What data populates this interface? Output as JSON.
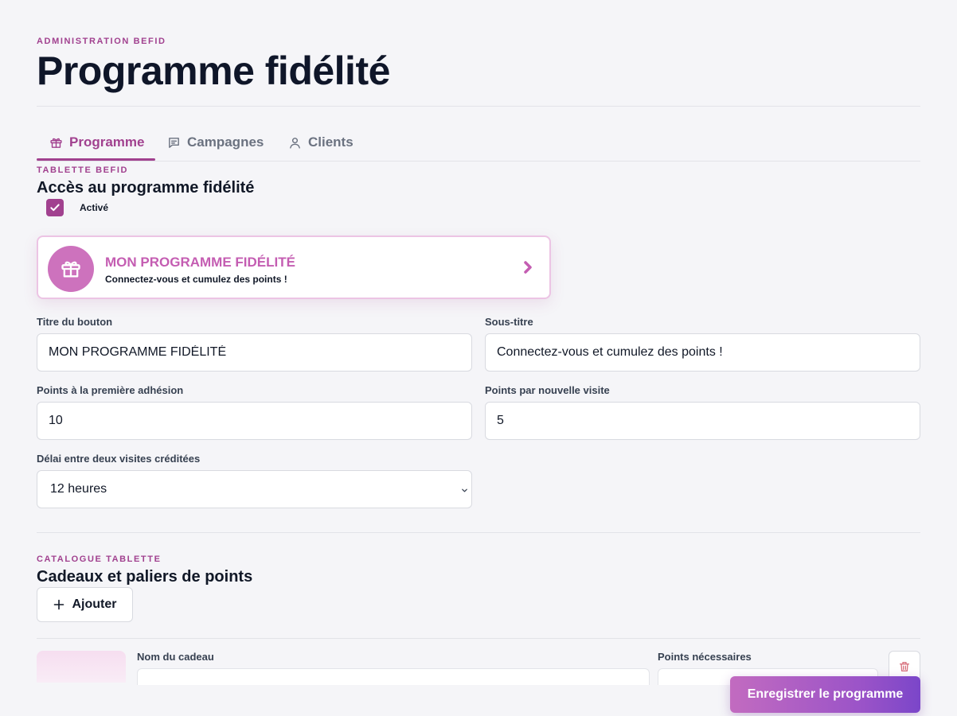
{
  "header": {
    "eyebrow": "ADMINISTRATION BEFID",
    "title": "Programme fidélité"
  },
  "tabs": [
    {
      "label": "Programme",
      "icon": "gift-icon",
      "active": true
    },
    {
      "label": "Campagnes",
      "icon": "chat-icon",
      "active": false
    },
    {
      "label": "Clients",
      "icon": "user-icon",
      "active": false
    }
  ],
  "access": {
    "eyebrow": "TABLETTE BEFID",
    "title": "Accès au programme fidélité",
    "checkbox_label": "Activé",
    "checked": true
  },
  "preview": {
    "title": "MON PROGRAMME FIDÉLITÉ",
    "subtitle": "Connectez-vous et cumulez des points !",
    "icon": "gift-icon"
  },
  "form": {
    "button_title": {
      "label": "Titre du bouton",
      "value": "MON PROGRAMME FIDÉLITÉ"
    },
    "subtitle": {
      "label": "Sous-titre",
      "value": "Connectez-vous et cumulez des points !"
    },
    "first_points": {
      "label": "Points à la première adhésion",
      "value": "10"
    },
    "visit_points": {
      "label": "Points par nouvelle visite",
      "value": "5"
    },
    "delay": {
      "label": "Délai entre deux visites créditées",
      "value": "12 heures"
    }
  },
  "catalog": {
    "eyebrow": "CATALOGUE TABLETTE",
    "title": "Cadeaux et paliers de points",
    "add_label": "Ajouter",
    "gift_name_label": "Nom du cadeau",
    "points_label": "Points nécessaires"
  },
  "save_label": "Enregistrer le programme",
  "colors": {
    "accent": "#a1418f",
    "preview_accent": "#cd72bd",
    "save_gradient_start": "#c26bc0",
    "save_gradient_end": "#7b46c9"
  }
}
